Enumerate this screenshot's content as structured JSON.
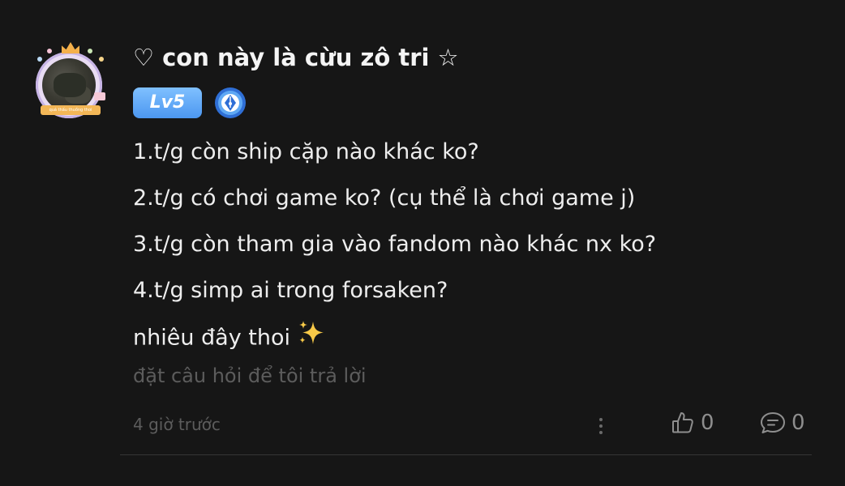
{
  "comment": {
    "username": "♡ con này là cừu zô tri ☆",
    "avatar": {
      "banner_text": "quá thấu thuồng thoi"
    },
    "level_badge": "Lv5",
    "badge_icon": "pen-nib-icon",
    "lines": [
      "1.t/g còn ship cặp nào khác ko?",
      "2.t/g có chơi game ko? (cụ thể là chơi game j)",
      "3.t/g còn tham gia vào fandom nào khác nx ko?",
      "4.t/g simp ai trong forsaken?",
      "nhiêu đây thoi"
    ],
    "hint": "đặt câu hỏi để tôi trả lời",
    "time": "4 giờ trước",
    "like_count": "0",
    "reply_count": "0"
  },
  "colors": {
    "background": "#161616",
    "text": "#eeeeee",
    "muted": "#5c5c5c",
    "level_badge": "#5aa6f5",
    "icon": "#8e8e8e"
  }
}
